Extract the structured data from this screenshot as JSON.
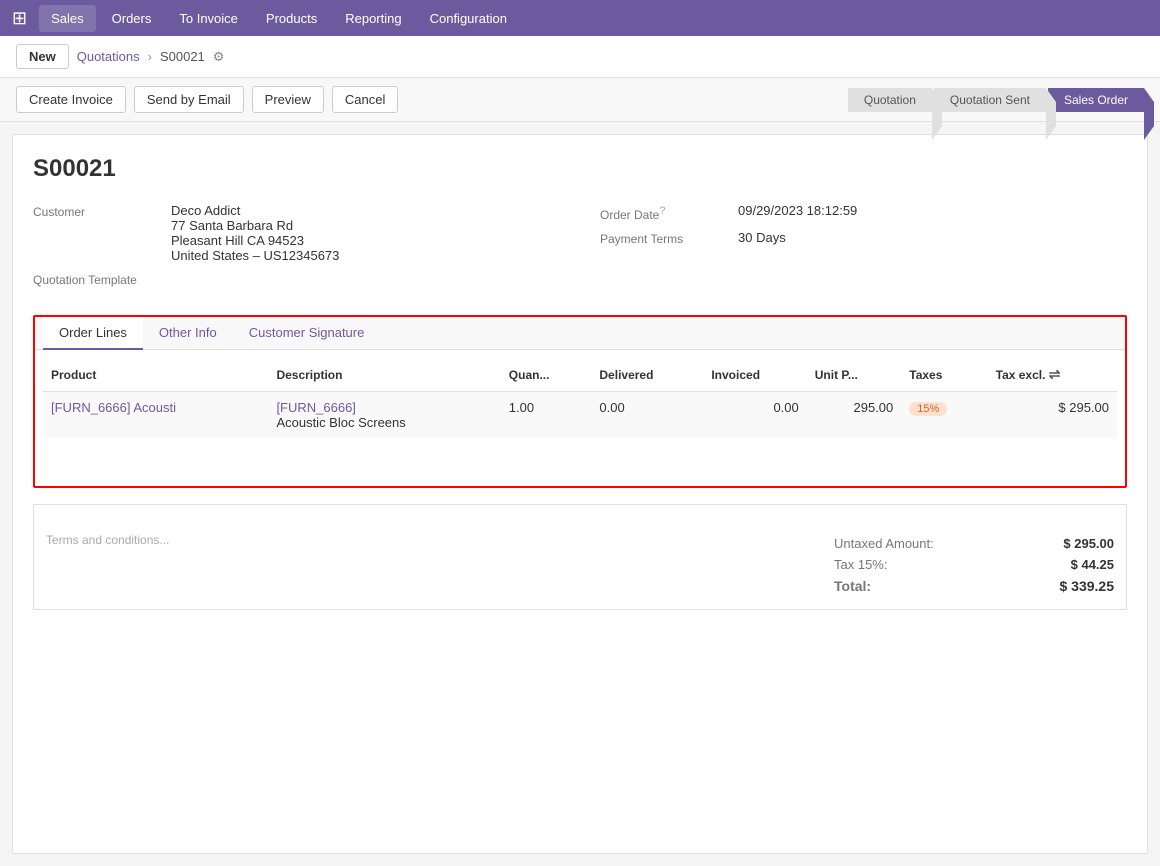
{
  "topnav": {
    "app_icon": "⊞",
    "items": [
      {
        "label": "Sales",
        "active": true
      },
      {
        "label": "Orders"
      },
      {
        "label": "To Invoice"
      },
      {
        "label": "Products"
      },
      {
        "label": "Reporting"
      },
      {
        "label": "Configuration"
      }
    ]
  },
  "breadcrumb": {
    "new_label": "New",
    "parent_label": "Quotations",
    "current_label": "S00021",
    "gear_icon": "⚙"
  },
  "actions": {
    "create_invoice": "Create Invoice",
    "send_by_email": "Send by Email",
    "preview": "Preview",
    "cancel": "Cancel"
  },
  "status_steps": [
    {
      "label": "Quotation",
      "active": false
    },
    {
      "label": "Quotation Sent",
      "active": false
    },
    {
      "label": "Sales Order",
      "active": true
    }
  ],
  "record": {
    "title": "S00021",
    "customer_label": "Customer",
    "customer_name": "Deco Addict",
    "customer_address_line1": "77 Santa Barbara Rd",
    "customer_address_line2": "Pleasant Hill CA 94523",
    "customer_address_line3": "United States – US12345673",
    "quotation_template_label": "Quotation Template",
    "order_date_label": "Order Date",
    "order_date_value": "09/29/2023 18:12:59",
    "payment_terms_label": "Payment Terms",
    "payment_terms_value": "30 Days"
  },
  "tabs": [
    {
      "label": "Order Lines",
      "active": true
    },
    {
      "label": "Other Info",
      "link": true
    },
    {
      "label": "Customer Signature",
      "link": true
    }
  ],
  "table": {
    "headers": [
      {
        "label": "Product",
        "align": "left"
      },
      {
        "label": "Description",
        "align": "left"
      },
      {
        "label": "Quan...",
        "align": "left"
      },
      {
        "label": "Delivered",
        "align": "left"
      },
      {
        "label": "Invoiced",
        "align": "right"
      },
      {
        "label": "Unit P...",
        "align": "right"
      },
      {
        "label": "Taxes",
        "align": "left"
      },
      {
        "label": "Tax excl.",
        "align": "right"
      }
    ],
    "rows": [
      {
        "product_name": "[FURN_6666] Acousti",
        "description_line1": "[FURN_6666]",
        "description_line2": "Acoustic Bloc Screens",
        "quantity": "1.00",
        "delivered": "0.00",
        "invoiced": "0.00",
        "unit_price": "295.00",
        "taxes": "15%",
        "tax_excl": "$ 295.00"
      }
    ]
  },
  "terms": {
    "placeholder": "Terms and conditions..."
  },
  "totals": {
    "untaxed_label": "Untaxed Amount:",
    "untaxed_value": "$ 295.00",
    "tax_label": "Tax 15%:",
    "tax_value": "$ 44.25",
    "total_label": "Total:",
    "total_value": "$ 339.25"
  }
}
